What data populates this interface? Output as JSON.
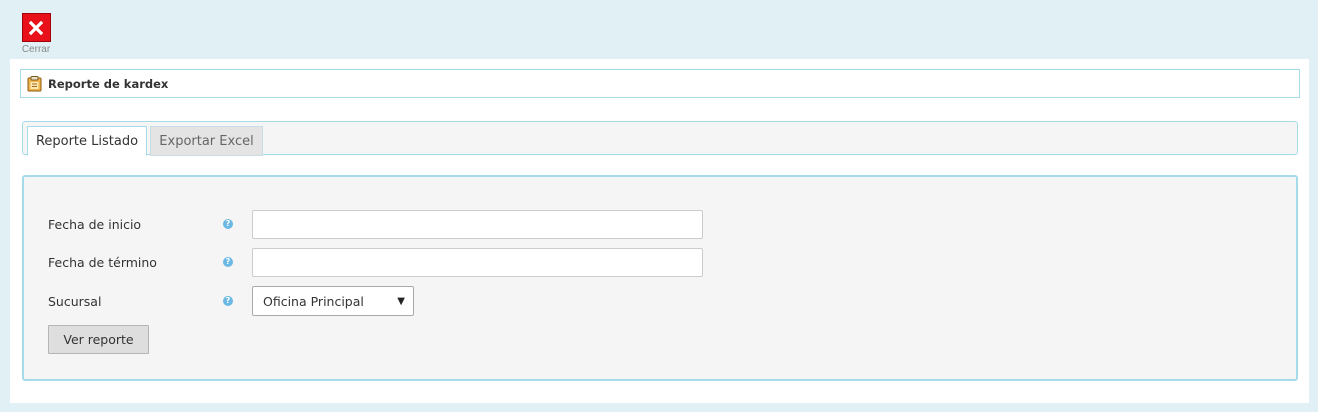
{
  "toolbar": {
    "close_label": "Cerrar",
    "close_icon": "close-x-icon",
    "close_color": "#e8101a"
  },
  "header": {
    "title": "Reporte de kardex",
    "icon": "report-clipboard-icon"
  },
  "tabs": [
    {
      "label": "Reporte Listado",
      "active": true
    },
    {
      "label": "Exportar Excel",
      "active": false
    }
  ],
  "form": {
    "fields": [
      {
        "label": "Fecha de inicio",
        "value": "",
        "help_icon": "help-question-icon"
      },
      {
        "label": "Fecha de término",
        "value": "",
        "help_icon": "help-question-icon"
      },
      {
        "label": "Sucursal",
        "selected": "Oficina Principal",
        "help_icon": "help-question-icon"
      }
    ],
    "submit_label": "Ver reporte"
  },
  "colors": {
    "background": "#e1f0f5",
    "border_accent": "#a6dbe9",
    "help_icon": "#6cb8e4"
  }
}
